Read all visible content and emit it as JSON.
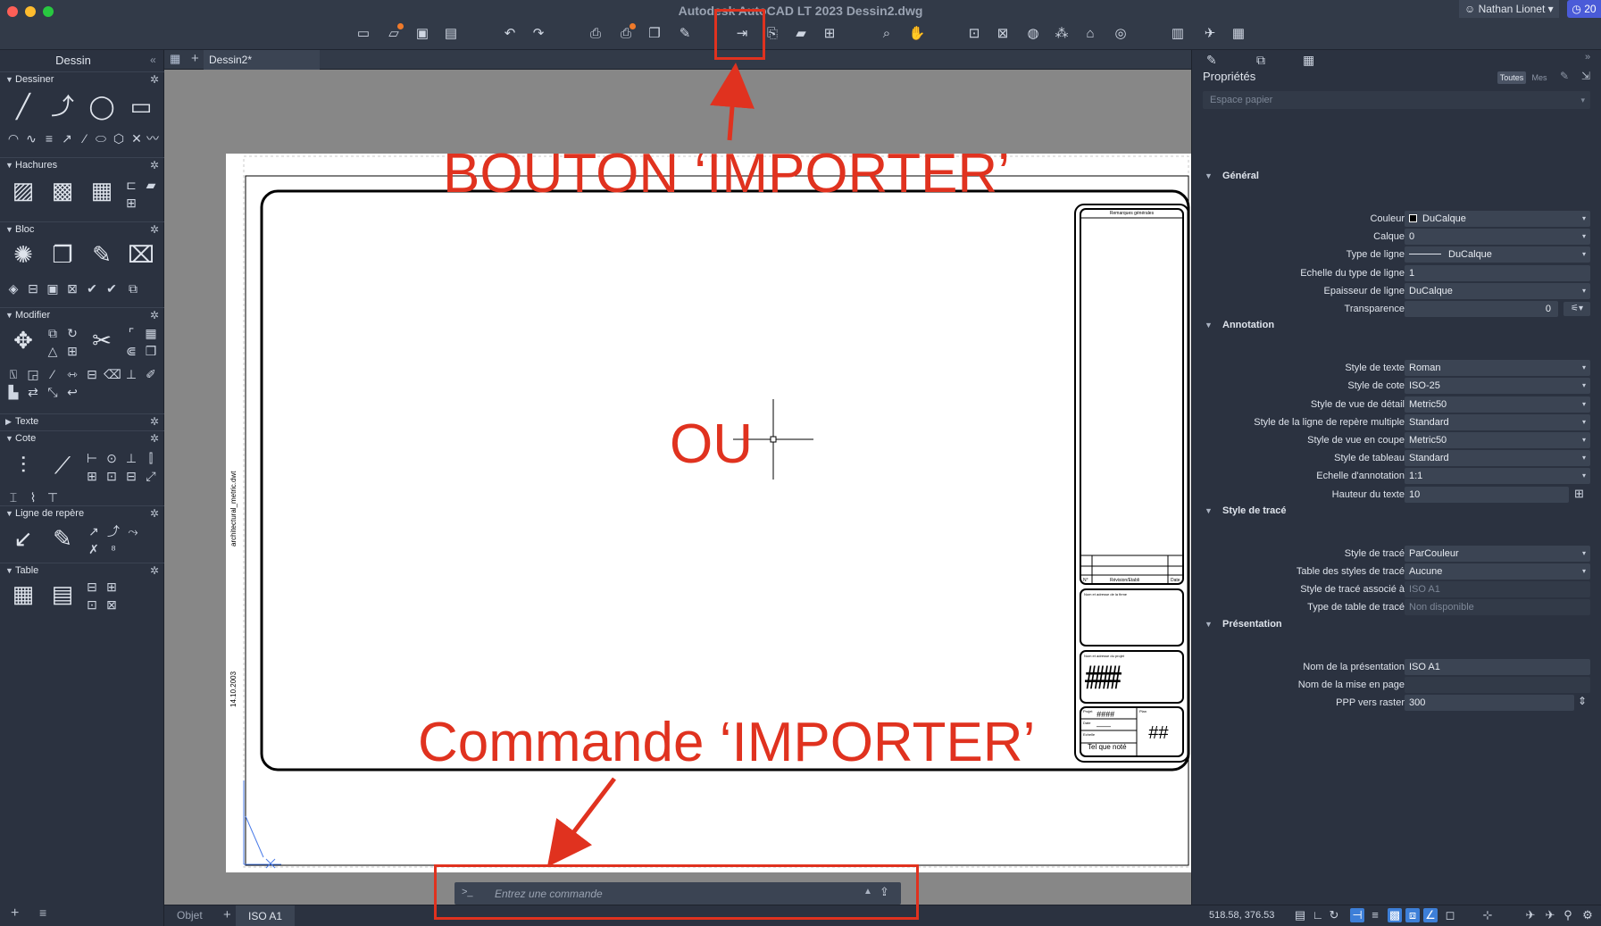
{
  "window": {
    "title": "Autodesk AutoCAD LT 2023   Dessin2.dwg",
    "user": "Nathan Lionet",
    "notifications": "20"
  },
  "toolbar": {
    "icons": [
      "new-file-icon",
      "open-file-icon",
      "save-icon",
      "save-as-icon",
      "undo-icon",
      "redo-icon",
      "plot-icon",
      "batch-plot-icon",
      "publish-icon",
      "export-pdf-icon",
      "import-icon",
      "attach-icon",
      "share-view-icon",
      "xref-icon",
      "zoom-window-icon",
      "pan-icon",
      "block-editor-icon",
      "insert-block-icon",
      "web-share-icon",
      "design-center-icon",
      "pdf-import-icon",
      "dwg-compare-icon",
      "trace-icon",
      "share-icon",
      "layout-icon"
    ]
  },
  "left_panel": {
    "title": "Dessin",
    "sections": [
      {
        "label": "Dessiner"
      },
      {
        "label": "Hachures"
      },
      {
        "label": "Bloc"
      },
      {
        "label": "Modifier"
      },
      {
        "label": "Texte"
      },
      {
        "label": "Cote"
      },
      {
        "label": "Ligne de repère"
      },
      {
        "label": "Table"
      }
    ]
  },
  "drawing_tabs": {
    "active": "Dessin2*"
  },
  "layout_tabs": {
    "model": "Objet",
    "active": "ISO A1"
  },
  "paper": {
    "sheet_side_text": "architectural_metric.dwt",
    "date_text": "14.10.2003",
    "title_block": {
      "header": "Remarques générales",
      "col_rev": "Révision/Etabli",
      "col_date": "Date",
      "col_no": "N°",
      "owner_label": "Nom et adresse de la firme",
      "project_label": "Nom et adresse du projet",
      "project_value": "####",
      "projet_label": "Projet",
      "projet_value": "####",
      "plan_label": "Plan",
      "date_label": "Date",
      "date_value": "——",
      "echelle_label": "Echelle",
      "echelle_value": "Tel que noté",
      "sheet_label": "Feuille",
      "sheet_value": "##"
    }
  },
  "command_line": {
    "prompt": ">_",
    "placeholder": "Entrez une commande"
  },
  "properties": {
    "title": "Propriétés",
    "filter_all": "Toutes",
    "filter_mine": "Mes",
    "space": "Espace papier",
    "groups": [
      {
        "label": "Général",
        "rows": [
          {
            "label": "Couleur",
            "value": "DuCalque",
            "kind": "color"
          },
          {
            "label": "Calque",
            "value": "0",
            "kind": "select"
          },
          {
            "label": "Type de ligne",
            "value": "DuCalque",
            "kind": "linetype"
          },
          {
            "label": "Echelle du type de ligne",
            "value": "1",
            "kind": "text"
          },
          {
            "label": "Epaisseur de ligne",
            "value": "DuCalque",
            "kind": "select"
          },
          {
            "label": "Transparence",
            "value": "0",
            "kind": "slider"
          }
        ]
      },
      {
        "label": "Annotation",
        "rows": [
          {
            "label": "Style de texte",
            "value": "Roman",
            "kind": "select"
          },
          {
            "label": "Style de cote",
            "value": "ISO-25",
            "kind": "select"
          },
          {
            "label": "Style de vue de détail",
            "value": "Metric50",
            "kind": "select"
          },
          {
            "label": "Style de la ligne de repère multiple",
            "value": "Standard",
            "kind": "select"
          },
          {
            "label": "Style de vue en coupe",
            "value": "Metric50",
            "kind": "select"
          },
          {
            "label": "Style de tableau",
            "value": "Standard",
            "kind": "select"
          },
          {
            "label": "Echelle d'annotation",
            "value": "1:1",
            "kind": "select"
          },
          {
            "label": "Hauteur du texte",
            "value": "10",
            "kind": "text"
          }
        ]
      },
      {
        "label": "Style de tracé",
        "rows": [
          {
            "label": "Style de tracé",
            "value": "ParCouleur",
            "kind": "select"
          },
          {
            "label": "Table des styles de tracé",
            "value": "Aucune",
            "kind": "select"
          },
          {
            "label": "Style de tracé associé à",
            "value": "ISO A1",
            "kind": "readonly"
          },
          {
            "label": "Type de table de tracé",
            "value": "Non disponible",
            "kind": "readonly"
          }
        ]
      },
      {
        "label": "Présentation",
        "rows": [
          {
            "label": "Nom de la présentation",
            "value": "ISO A1",
            "kind": "text"
          },
          {
            "label": "Nom de la mise en page",
            "value": "",
            "kind": "readonly"
          },
          {
            "label": "PPP vers raster",
            "value": "300",
            "kind": "spinner"
          }
        ]
      }
    ]
  },
  "status_bar": {
    "coordinates": "518.58, 376.53"
  },
  "annotations": {
    "button_label": "BOUTON ‘IMPORTER’",
    "or_label": "OU",
    "command_label": "Commande ‘IMPORTER’",
    "color": "#e0321f"
  }
}
